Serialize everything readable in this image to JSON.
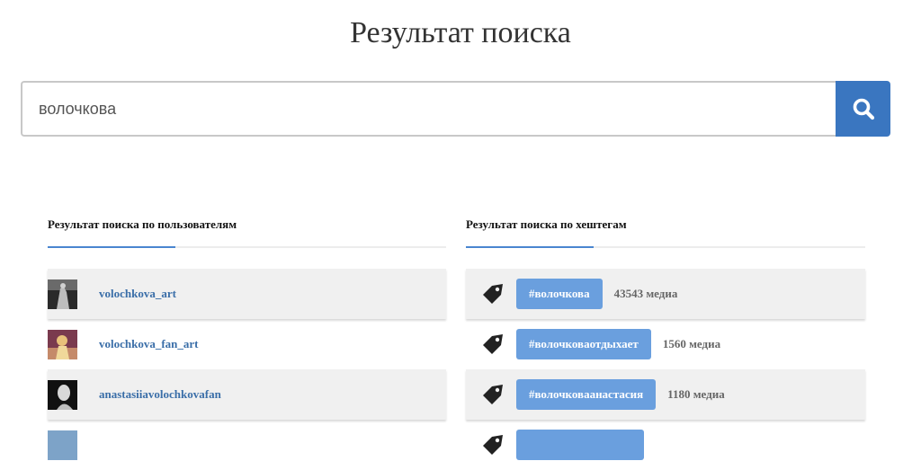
{
  "header": {
    "title": "Результат поиска"
  },
  "search": {
    "value": "волочкова",
    "button_icon": "search-icon",
    "button_color": "#3a76c0"
  },
  "users_section": {
    "heading": "Результат поиска по пользователям",
    "items": [
      {
        "username": "volochkova_art"
      },
      {
        "username": "volochkova_fan_art"
      },
      {
        "username": "anastasiiavolochkovafan"
      }
    ]
  },
  "tags_section": {
    "heading": "Результат поиска по хештегам",
    "items": [
      {
        "tag": "#волочкова",
        "count": "43543 медиа"
      },
      {
        "tag": "#волочковаотдыхает",
        "count": "1560 медиа"
      },
      {
        "tag": "#волочковаанастасия",
        "count": "1180 медиа"
      }
    ]
  },
  "colors": {
    "accent": "#4a86d0",
    "chip": "#6a9fde",
    "link": "#3a6ea8"
  }
}
